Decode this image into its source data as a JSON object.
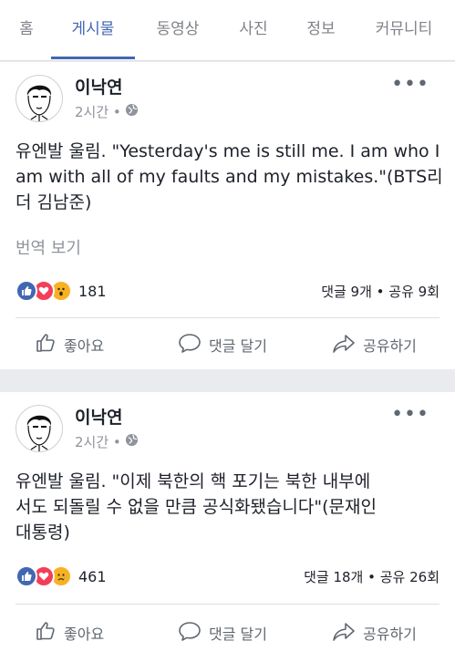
{
  "tabs": [
    {
      "label": "홈"
    },
    {
      "label": "게시물",
      "active": true
    },
    {
      "label": "동영상"
    },
    {
      "label": "사진"
    },
    {
      "label": "정보"
    },
    {
      "label": "커뮤니티"
    }
  ],
  "colors": {
    "accent": "#4267b2",
    "like": "#4267b2",
    "love": "#f33e58",
    "emoji": "#f7b125"
  },
  "posts": [
    {
      "author": "이낙연",
      "time": "2시간 •",
      "more": "•••",
      "text": "유엔발 울림. \"Yesterday's me is still me. I am who I am with all of my faults and my mistakes.\"(BTS리더 김남준)",
      "translate": "번역 보기",
      "reactions": {
        "icons": [
          "like-icon",
          "love-icon",
          "wow-icon"
        ],
        "count": "181"
      },
      "stats": "댓글 9개 • 공유 9회",
      "actions": {
        "like": "좋아요",
        "comment": "댓글 달기",
        "share": "공유하기"
      }
    },
    {
      "author": "이낙연",
      "time": "2시간 •",
      "more": "•••",
      "text": "유엔발 울림. \"이제 북한의 핵 포기는 북한 내부에서도 되돌릴 수 없을 만큼 공식화됐습니다\"(문재인 대통령)",
      "reactions": {
        "icons": [
          "like-icon",
          "love-icon",
          "sad-icon"
        ],
        "count": "461"
      },
      "stats": "댓글 18개 • 공유 26회",
      "actions": {
        "like": "좋아요",
        "comment": "댓글 달기",
        "share": "공유하기"
      }
    }
  ]
}
